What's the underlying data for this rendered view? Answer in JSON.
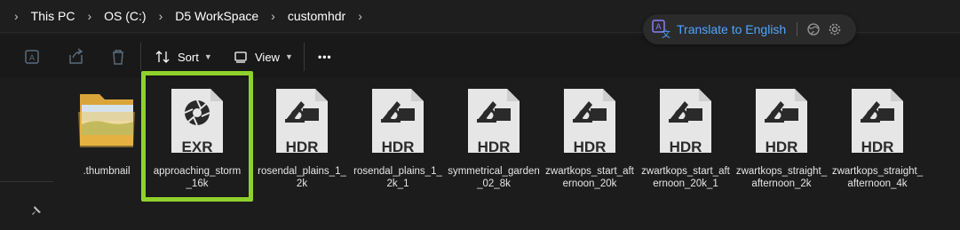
{
  "breadcrumb": [
    "This PC",
    "OS (C:)",
    "D5 WorkSpace",
    "customhdr"
  ],
  "translate": {
    "label": "Translate to English"
  },
  "toolbar": {
    "sort_label": "Sort",
    "view_label": "View",
    "more_label": "•••"
  },
  "files": [
    {
      "name": ".thumbnail",
      "type": "folder",
      "tag": ""
    },
    {
      "name": "approaching_storm_16k",
      "type": "exr",
      "tag": "EXR",
      "selected": true
    },
    {
      "name": "rosendal_plains_1_2k",
      "type": "hdr",
      "tag": "HDR"
    },
    {
      "name": "rosendal_plains_1_2k_1",
      "type": "hdr",
      "tag": "HDR"
    },
    {
      "name": "symmetrical_garden_02_8k",
      "type": "hdr",
      "tag": "HDR"
    },
    {
      "name": "zwartkops_start_afternoon_20k",
      "type": "hdr",
      "tag": "HDR"
    },
    {
      "name": "zwartkops_start_afternoon_20k_1",
      "type": "hdr",
      "tag": "HDR"
    },
    {
      "name": "zwartkops_straight_afternoon_2k",
      "type": "hdr",
      "tag": "HDR"
    },
    {
      "name": "zwartkops_straight_afternoon_4k",
      "type": "hdr",
      "tag": "HDR"
    }
  ],
  "colors": {
    "accent_selection": "#8fd12c",
    "link": "#4ea6ff",
    "background": "#1c1c1c"
  }
}
